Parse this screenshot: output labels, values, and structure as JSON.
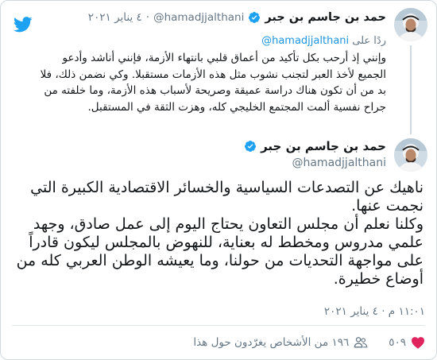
{
  "colors": {
    "accent": "#1da1f2",
    "text": "#14171a",
    "secondary": "#657786",
    "link": "#1b95e0",
    "like_red": "#e0245e",
    "border": "#cfd9de"
  },
  "parent_tweet": {
    "display_name": "حمد بن جاسم بن جبر",
    "handle": "@hamadjjalthani",
    "dot": "·",
    "date": "٤ يناير ٢٠٢١",
    "reply_prefix": "ردًا على",
    "reply_to": "@hamadjjalthani",
    "text": "وإنني إذ أرحب بكل تأكيد من أعماق قلبي بانتهاء الأزمة، فإنني أناشد وأدعو الجميع لأخذ العبر لتجنب نشوب مثل هذه الأزمات مستقبلا. وكي نضمن ذلك، فلا بد من أن تكون هناك دراسة عميقة وصريحة لأسباب هذه الأزمة، وما خلفته من جراح نفسية ألمت المجتمع الخليجي كله، وهزت الثقة في المستقبل.",
    "avatar_icon": "person-avatar",
    "verified_icon": "verified-badge-icon"
  },
  "brand_icon": "twitter-bird-icon",
  "main_tweet": {
    "display_name": "حمد بن جاسم بن جبر",
    "handle": "@hamadjjalthani",
    "paragraph_1": "ناهيك عن التصدعات السياسية والخسائر الاقتصادية الكبيرة التي نجمت عنها.",
    "paragraph_2": "وكلنا نعلم أن مجلس التعاون يحتاج اليوم إلى عمل صادق، وجهد علمي مدروس ومخطط له بعناية، للنهوض بالمجلس ليكون قادراً على مواجهة التحديات من حولنا، وما يعيشه الوطن العربي كله من أوضاع خطيرة.",
    "timestamp": "١١:٠١ م · ٤ يناير ٢٠٢١",
    "likes": "٥٠٩",
    "retweeters": "١٩٦ من الأشخاص يغرّدون حول هذا",
    "like_icon": "heart-icon",
    "people_icon": "people-icon"
  }
}
